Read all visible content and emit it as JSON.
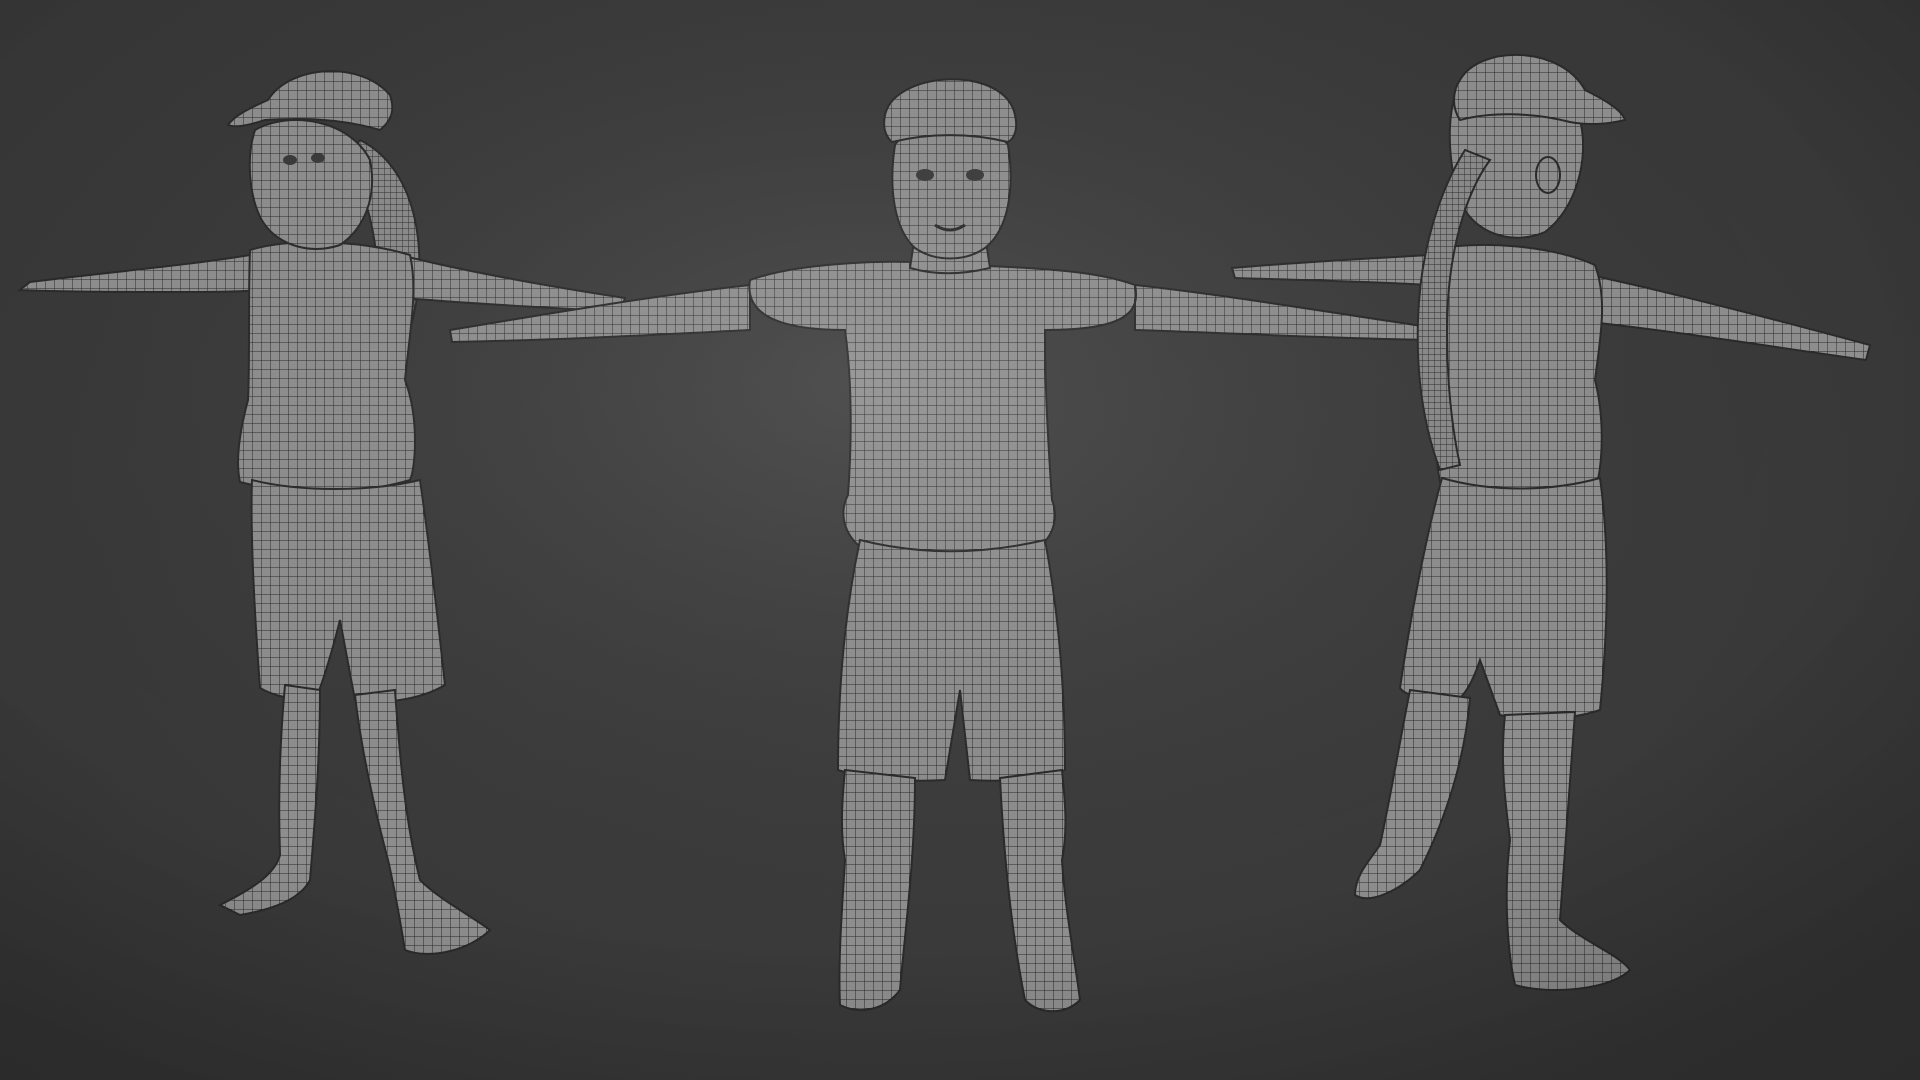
{
  "scene": {
    "background_color": "#3a3a3a",
    "mesh_fill_color": "#8e8e8e",
    "mesh_wire_color": "#2a2a2a",
    "shading": "wireframe-on-shaded",
    "pose": "T-pose",
    "figures": [
      {
        "view": "three-quarter-left",
        "has_cap": true,
        "has_ponytail": true
      },
      {
        "view": "front",
        "has_cap": true,
        "has_ponytail": false
      },
      {
        "view": "three-quarter-back-right",
        "has_cap": true,
        "has_ponytail": true
      }
    ]
  }
}
